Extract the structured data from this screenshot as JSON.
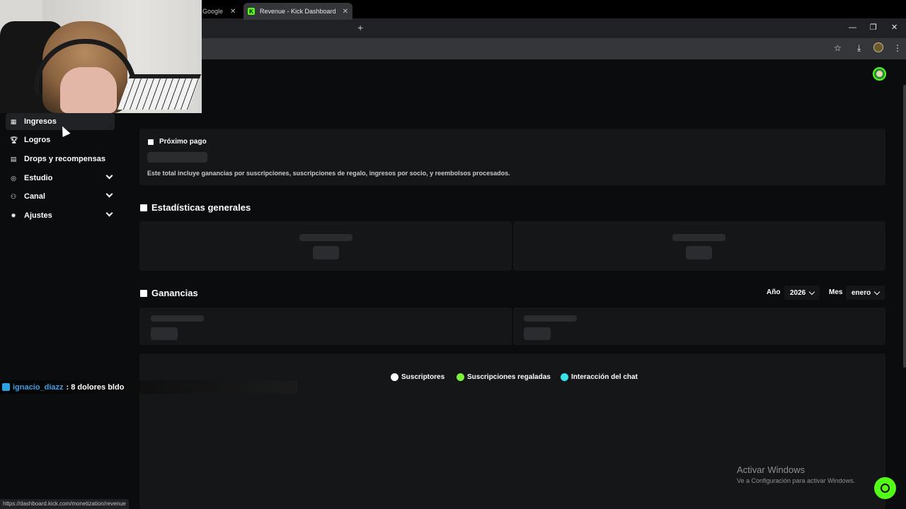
{
  "browser": {
    "tabs": [
      {
        "label": "Google"
      },
      {
        "label": "Revenue - Kick Dashboard"
      }
    ],
    "status_url": "https://dashboard.kick.com/monetization/revenue"
  },
  "sidebar": {
    "items": [
      {
        "label": "Ingresos",
        "icon": "revenue-icon",
        "active": true
      },
      {
        "label": "Logros",
        "icon": "trophy-icon"
      },
      {
        "label": "Drops y recompensas",
        "icon": "drops-icon"
      },
      {
        "label": "Estudio",
        "icon": "studio-icon",
        "expandable": true
      },
      {
        "label": "Canal",
        "icon": "channel-icon",
        "expandable": true
      },
      {
        "label": "Ajustes",
        "icon": "gear-icon",
        "expandable": true
      }
    ]
  },
  "next_payment": {
    "title": "Próximo pago",
    "note": "Este total incluye ganancias por suscripciones, suscripciones de regalo, ingresos por socio, y reembolsos procesados."
  },
  "stats": {
    "title": "Estadísticas generales"
  },
  "earnings": {
    "title": "Ganancias",
    "year_label": "Año",
    "year_value": "2026",
    "month_label": "Mes",
    "month_value": "enero"
  },
  "legend": [
    {
      "label": "Suscriptores",
      "color": "#ffffff"
    },
    {
      "label": "Suscripciones regaladas",
      "color": "#7cf23c"
    },
    {
      "label": "Interacción del chat",
      "color": "#36e3e8"
    }
  ],
  "chat": {
    "user": "ignacio_diazz",
    "message": ": 8 dolores bldo"
  },
  "windows_watermark": {
    "title": "Activar Windows",
    "subtitle": "Ve a Configuración para activar Windows."
  },
  "colors": {
    "accent": "#53fc18",
    "background": "#0b0c0d",
    "card": "#151618"
  }
}
